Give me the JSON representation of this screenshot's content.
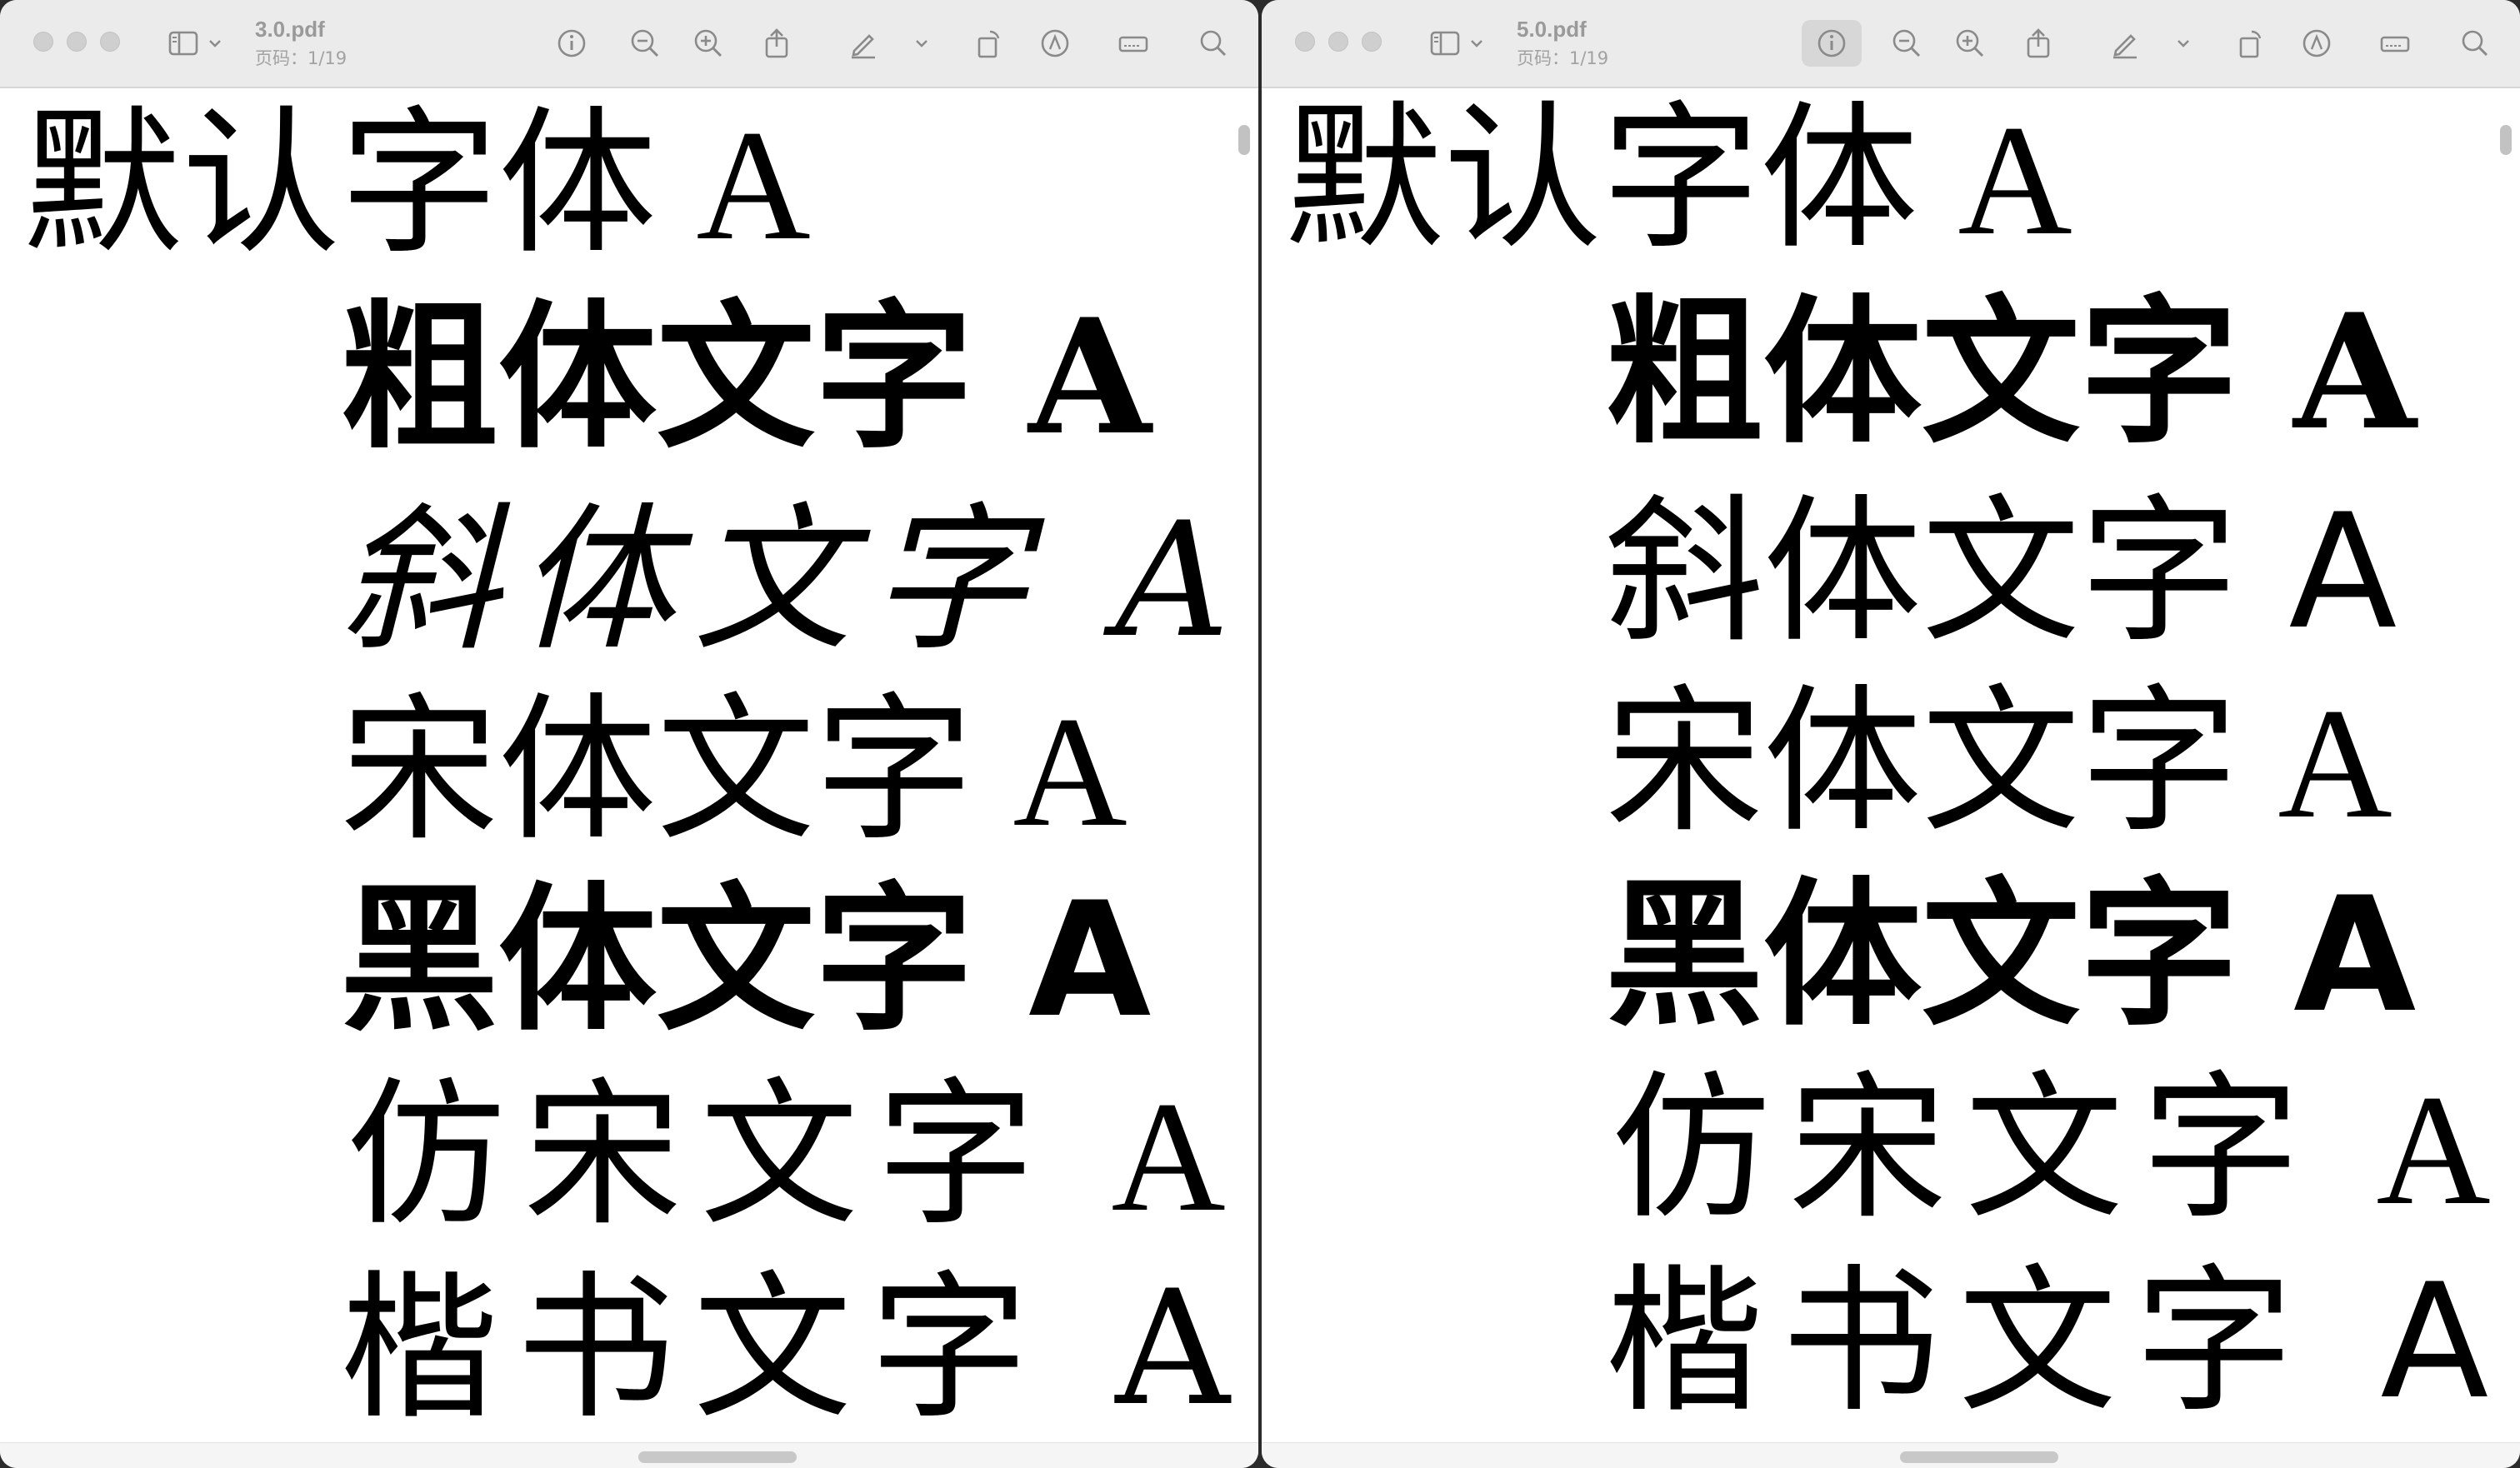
{
  "left": {
    "title": "3.0.pdf",
    "page_info": "页码：1/19",
    "lines": {
      "default": "默认字体 A",
      "bold": "粗体文字 A",
      "italic": "斜体文字 A",
      "song": "宋体文字 A",
      "hei": "黑体文字 A",
      "fangsong": "仿宋文字 A",
      "kai": "楷书文字 A"
    }
  },
  "right": {
    "title": "5.0.pdf",
    "page_info": "页码：1/19",
    "lines": {
      "default": "默认字体 A",
      "bold": "粗体文字 A",
      "italic": "斜体文字 A",
      "song": "宋体文字 A",
      "hei": "黑体文字 A",
      "fangsong": "仿宋文字 A",
      "kai": "楷书文字 A"
    }
  },
  "toolbar_icons": [
    "sidebar-icon",
    "chevron-down-icon",
    "info-icon",
    "zoom-out-icon",
    "zoom-in-icon",
    "share-icon",
    "markup-pen-icon",
    "chevron-down-icon",
    "rotate-icon",
    "markup-icon",
    "form-fill-icon",
    "search-icon"
  ],
  "colors": {
    "toolbar_bg": "#ebebeb",
    "text": "#000000",
    "active_button": "#d7d7d7"
  }
}
